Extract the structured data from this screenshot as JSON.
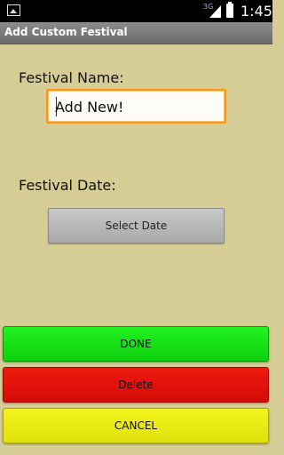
{
  "status_bar": {
    "network": "3G",
    "time": "1:45",
    "icons": [
      "image-notification-icon",
      "signal-icon",
      "battery-icon"
    ]
  },
  "title_bar": {
    "title": "Add Custom Festival"
  },
  "form": {
    "name_label": "Festival Name:",
    "name_value": "Add New!",
    "date_label": "Festival Date:",
    "select_date_label": "Select Date"
  },
  "buttons": {
    "done": "DONE",
    "delete": "Delete",
    "cancel": "CANCEL"
  },
  "colors": {
    "background": "#d6cd96",
    "done": "#1ae61a",
    "delete": "#e0120b",
    "cancel": "#eaea15",
    "input_focus": "#f39a1a"
  }
}
